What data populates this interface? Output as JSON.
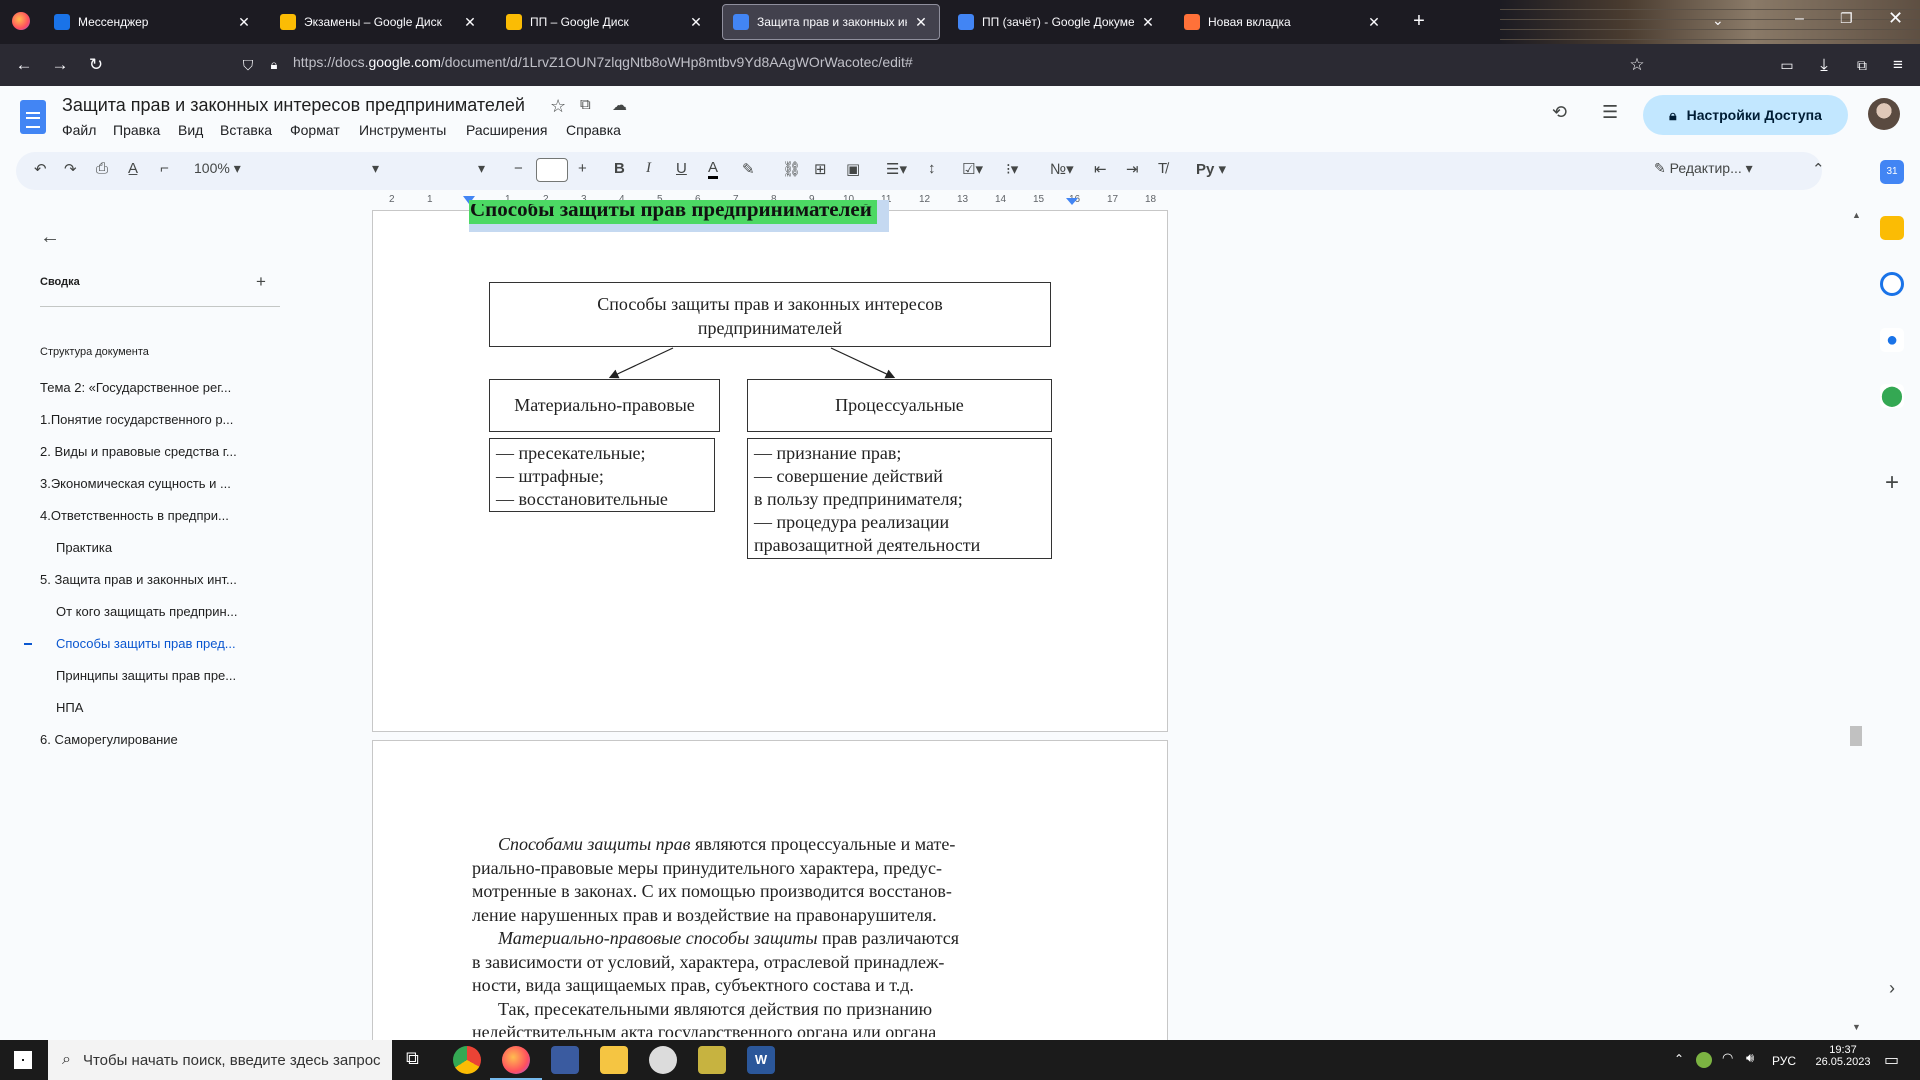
{
  "browser": {
    "tabs": [
      {
        "title": "Мессенджер",
        "favicon": "messenger-icon",
        "color": "#1a73e8",
        "active": false
      },
      {
        "title": "Экзамены – Google Диск",
        "favicon": "drive-icon",
        "color": "#fbbc04",
        "active": false
      },
      {
        "title": "ПП – Google Диск",
        "favicon": "drive-icon",
        "color": "#fbbc04",
        "active": false
      },
      {
        "title": "Защита прав и законных инте...",
        "favicon": "docs-icon",
        "color": "#4285f4",
        "active": true
      },
      {
        "title": "ПП (зачёт) - Google Документ",
        "favicon": "docs-icon",
        "color": "#4285f4",
        "active": false
      },
      {
        "title": "Новая вкладка",
        "favicon": "firefox-icon",
        "color": "#ff7139",
        "active": false
      }
    ],
    "new_tab": "+",
    "url_prefix": "https://docs.",
    "url_domain": "google.com",
    "url_rest": "/document/d/1LrvZ1OUN7zlqgNtb8oWHp8mtbv9Yd8AAgWOrWacotec/edit#"
  },
  "docs": {
    "title": "Защита прав и законных интересов предпринимателей",
    "menu": [
      "Файл",
      "Правка",
      "Вид",
      "Вставка",
      "Формат",
      "Инструменты",
      "Расширения",
      "Справка"
    ],
    "share_label": "Настройки Доступа",
    "zoom": "100%",
    "mode_label": "Редактир...",
    "ruler_numbers": [
      "2",
      "1",
      "1",
      "2",
      "3",
      "4",
      "5",
      "6",
      "7",
      "8",
      "9",
      "10",
      "11",
      "12",
      "13",
      "14",
      "15",
      "16",
      "17",
      "18"
    ]
  },
  "outline": {
    "summary_label": "Сводка",
    "add_label": "+",
    "structure_label": "Структура документа",
    "items": [
      {
        "text": "Тема 2: «Государственное рег...",
        "level": 1,
        "active": false
      },
      {
        "text": "1.Понятие государственного р...",
        "level": 1,
        "active": false
      },
      {
        "text": "2. Виды и правовые средства г...",
        "level": 1,
        "active": false
      },
      {
        "text": "3.Экономическая сущность и ...",
        "level": 1,
        "active": false
      },
      {
        "text": "4.Ответственность в предпри...",
        "level": 1,
        "active": false
      },
      {
        "text": "Практика",
        "level": 2,
        "active": false
      },
      {
        "text": "5. Защита прав и законных инт...",
        "level": 1,
        "active": false
      },
      {
        "text": "От кого защищать предприн...",
        "level": 2,
        "active": false
      },
      {
        "text": "Способы защиты прав пред...",
        "level": 2,
        "active": true
      },
      {
        "text": "Принципы защиты прав пре...",
        "level": 2,
        "active": false
      },
      {
        "text": "НПА",
        "level": 2,
        "active": false
      },
      {
        "text": "6. Саморегулирование",
        "level": 1,
        "active": false
      }
    ]
  },
  "page": {
    "heading": "Способы защиты прав предпринимателей",
    "diagram": {
      "top_line1": "Способы защиты прав и законных интересов",
      "top_line2": "предпринимателей",
      "left_title": "Материально-правовые",
      "right_title": "Процессуальные",
      "left_items": [
        "— пресекательные;",
        "— штрафные;",
        "— восстановительные"
      ],
      "right_items": [
        "— признание прав;",
        "— совершение действий",
        "в пользу предпринимателя;",
        "— процедура реализации",
        "правозащитной деятельности"
      ]
    },
    "paragraph_lines": [
      {
        "italic": "Способами защиты прав",
        "text": " являются процессуальные и мате-"
      },
      {
        "italic": "",
        "text": "риально-правовые меры принудительного характера, предус-"
      },
      {
        "italic": "",
        "text": "мотренные в законах. С их помощью производится восстанов-"
      },
      {
        "italic": "",
        "text": "ление  нарушенных прав и воздействие на правонарушителя."
      },
      {
        "italic": "Материально-правовые способы защиты",
        "text": " прав различаются"
      },
      {
        "italic": "",
        "text": "в зависимости от условий, характера, отраслевой принадлеж-"
      },
      {
        "italic": "",
        "text": "ности, вида защищаемых прав, субъектного состава и т.д."
      },
      {
        "italic": "",
        "text": "Так, пресекательными являются действия по признанию"
      },
      {
        "italic": "",
        "text": "недействительным акта государственного органа или органа"
      }
    ]
  },
  "taskbar": {
    "search_placeholder": "Чтобы начать поиск, введите здесь запрос",
    "lang": "РУС",
    "time": "19:37",
    "date": "26.05.2023"
  }
}
